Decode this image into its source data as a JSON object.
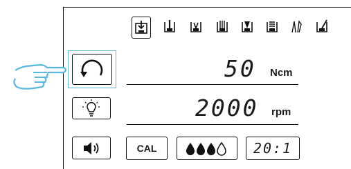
{
  "readouts": {
    "torque": {
      "value": "50",
      "unit": "Ncm"
    },
    "speed": {
      "value": "2000",
      "unit": "rpm"
    }
  },
  "buttons": {
    "cal_label": "CAL",
    "ratio_label": "20:1"
  },
  "mode_icons": [
    "handpiece-mode-1-icon",
    "handpiece-mode-2-icon",
    "handpiece-mode-3-icon",
    "handpiece-mode-4-icon",
    "handpiece-mode-5-icon",
    "handpiece-mode-6-icon",
    "drill-tools-icon",
    "implant-mode-icon"
  ],
  "colors": {
    "highlight": "#59b7e0",
    "ink": "#111111"
  }
}
